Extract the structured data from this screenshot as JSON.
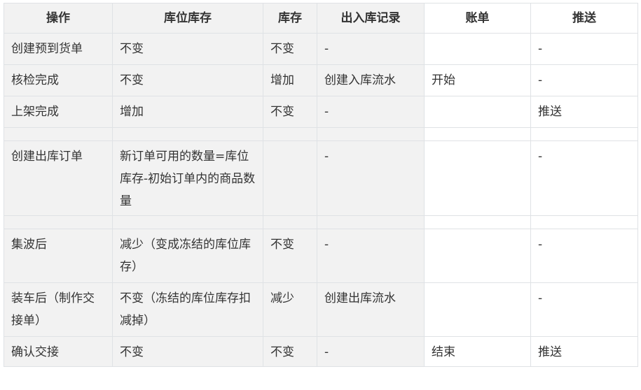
{
  "table": {
    "headers": [
      "操作",
      "库位库存",
      "库存",
      "出入库记录",
      "账单",
      "推送"
    ],
    "rows": [
      [
        "创建预到货单",
        "不变",
        "不变",
        "-",
        "",
        "-"
      ],
      [
        "核检完成",
        "不变",
        "增加",
        "创建入库流水",
        "开始",
        "-"
      ],
      [
        "上架完成",
        "增加",
        "不变",
        "-",
        "",
        "推送"
      ],
      [
        "",
        "",
        "",
        "",
        "",
        ""
      ],
      [
        "创建出库订单",
        "新订单可用的数量=库位库存-初始订单内的商品数量",
        "",
        "-",
        "",
        "-"
      ],
      [
        "",
        "",
        "",
        "",
        "",
        ""
      ],
      [
        "集波后",
        "减少（变成冻结的库位库存）",
        "不变",
        "-",
        "",
        "-"
      ],
      [
        "装车后（制作交接单）",
        "不变（冻结的库位库存扣减掉）",
        "减少",
        "创建出库流水",
        "",
        "-"
      ],
      [
        "确认交接",
        "不变",
        "不变",
        "-",
        "结束",
        "推送"
      ]
    ]
  }
}
